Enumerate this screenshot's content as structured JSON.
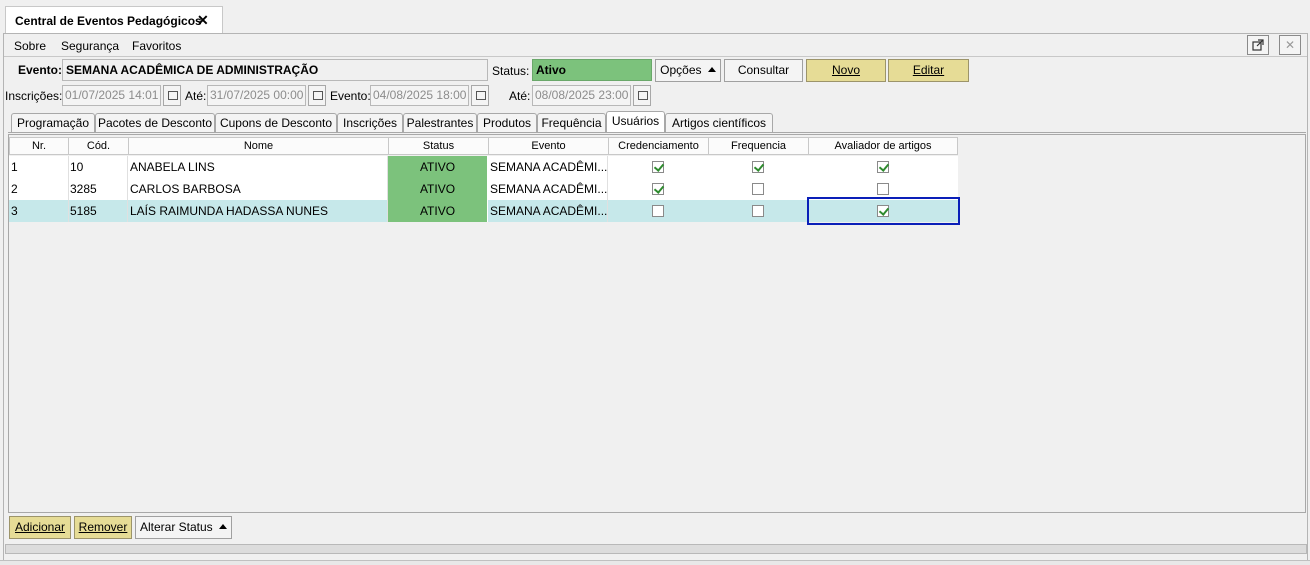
{
  "window": {
    "tab_title": "Central de Eventos Pedagógicos",
    "close_glyph": "✕"
  },
  "menu": [
    "Sobre",
    "Segurança",
    "Favoritos"
  ],
  "header": {
    "evento_label": "Evento:",
    "evento_value": "SEMANA ACADÊMICA DE ADMINISTRAÇÃO",
    "status_label": "Status:",
    "status_value": "Ativo",
    "opcoes_label": "Opções",
    "consultar_label": "Consultar",
    "novo_label": "Novo",
    "editar_label": "Editar",
    "inscricoes_label": "Inscrições:",
    "inscricoes_start": "01/07/2025 14:01",
    "ate1_label": "Até:",
    "inscricoes_end": "31/07/2025 00:00",
    "evento_date_label": "Evento:",
    "evento_start": "04/08/2025 18:00",
    "ate2_label": "Até:",
    "evento_end": "08/08/2025 23:00"
  },
  "tabs": [
    "Programação",
    "Pacotes de Desconto",
    "Cupons de Desconto",
    "Inscrições",
    "Palestrantes",
    "Produtos",
    "Frequência",
    "Usuários",
    "Artigos científicos"
  ],
  "active_tab": "Usuários",
  "table": {
    "columns": [
      "Nr.",
      "Cód.",
      "Nome",
      "Status",
      "Evento",
      "Credenciamento",
      "Frequencia",
      "Avaliador de artigos"
    ],
    "rows": [
      {
        "nr": "1",
        "cod": "10",
        "nome": "ANABELA LINS",
        "status": "ATIVO",
        "evento": "SEMANA ACADÊMI...",
        "credenciamento": true,
        "frequencia": true,
        "avaliador": true
      },
      {
        "nr": "2",
        "cod": "3285",
        "nome": "CARLOS BARBOSA",
        "status": "ATIVO",
        "evento": "SEMANA ACADÊMI...",
        "credenciamento": true,
        "frequencia": false,
        "avaliador": false
      },
      {
        "nr": "3",
        "cod": "5185",
        "nome": "LAÍS RAIMUNDA HADASSA NUNES",
        "status": "ATIVO",
        "evento": "SEMANA ACADÊMI...",
        "credenciamento": false,
        "frequencia": false,
        "avaliador": true
      }
    ],
    "selected_row": 2
  },
  "footer": {
    "adicionar_label": "Adicionar",
    "remover_label": "Remover",
    "alterar_status_label": "Alterar Status"
  },
  "colors": {
    "status_green": "#7cc27c",
    "selected_row": "#c6e8ea",
    "focus_border": "#0a1fb8",
    "yellow_button": "#e6dc96"
  },
  "icons": [
    "close-icon",
    "popout-icon",
    "window-close-icon",
    "calendar-icon",
    "caret-up-icon",
    "checkbox-icon"
  ]
}
